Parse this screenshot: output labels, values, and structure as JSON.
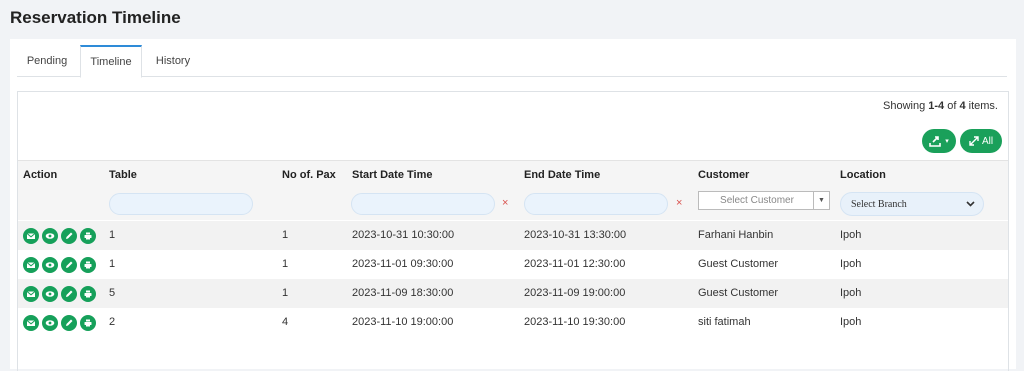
{
  "page": {
    "title": "Reservation Timeline"
  },
  "tabs": [
    {
      "label": "Pending"
    },
    {
      "label": "Timeline",
      "active": true
    },
    {
      "label": "History"
    }
  ],
  "summary": {
    "prefix": "Showing ",
    "range": "1-4",
    "of": " of ",
    "total": "4",
    "suffix": " items."
  },
  "toolbar": {
    "all_label": "All",
    "export_icon": "export-icon",
    "expand_icon": "expand-icon"
  },
  "columns": {
    "action": "Action",
    "table": "Table",
    "pax": "No of. Pax",
    "start": "Start Date Time",
    "end": "End Date Time",
    "customer": "Customer",
    "location": "Location"
  },
  "filters": {
    "clear_symbol": "×",
    "customer_placeholder": "Select Customer",
    "branch_placeholder": "Select Branch"
  },
  "rows": [
    {
      "table": "1",
      "pax": "1",
      "start": "2023-10-31 10:30:00",
      "end": "2023-10-31 13:30:00",
      "customer": "Farhani Hanbin",
      "location": "Ipoh"
    },
    {
      "table": "1",
      "pax": "1",
      "start": "2023-11-01 09:30:00",
      "end": "2023-11-01 12:30:00",
      "customer": "Guest Customer",
      "location": "Ipoh"
    },
    {
      "table": "5",
      "pax": "1",
      "start": "2023-11-09 18:30:00",
      "end": "2023-11-09 19:00:00",
      "customer": "Guest Customer",
      "location": "Ipoh"
    },
    {
      "table": "2",
      "pax": "4",
      "start": "2023-11-10 19:00:00",
      "end": "2023-11-10 19:30:00",
      "customer": "siti fatimah",
      "location": "Ipoh"
    }
  ],
  "row_actions": [
    "email-icon",
    "view-icon",
    "edit-icon",
    "print-icon"
  ],
  "colors": {
    "accent": "#16a05a",
    "tab_active": "#2e8bd8",
    "clear": "#d9534f"
  }
}
